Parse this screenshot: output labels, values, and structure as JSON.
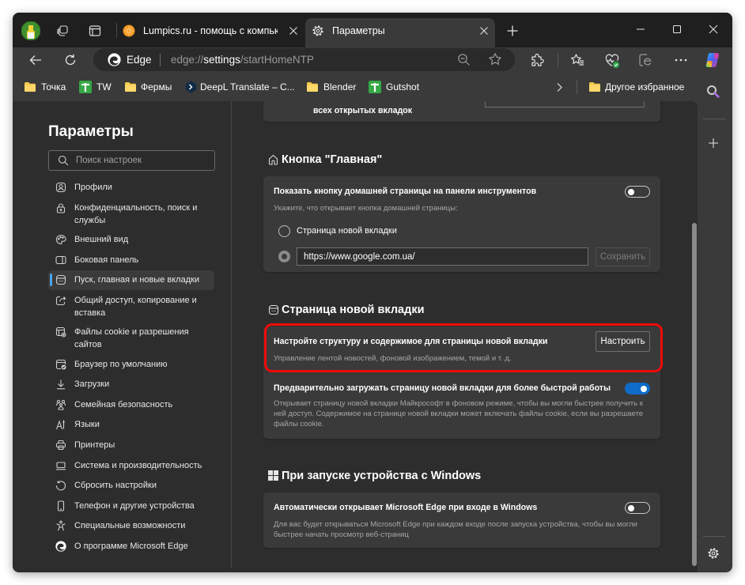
{
  "browser": {
    "tabs": [
      {
        "title": "Lumpics.ru - помощь с компьюте",
        "favicon": "orange-favicon-icon",
        "active": false
      },
      {
        "title": "Параметры",
        "favicon": "gear-icon",
        "active": true
      }
    ],
    "address_bar": {
      "brand": "Edge",
      "url_scheme": "edge://",
      "url_host": "settings",
      "url_path": "/startHomeNTP"
    },
    "toolbar_icons": [
      "back-icon",
      "refresh-icon",
      "zoom-out-icon",
      "favorite-star-icon",
      "extensions-icon",
      "favorites-icon",
      "browser-essentials-icon",
      "ie-mode-icon",
      "more-icon",
      "copilot-icon"
    ],
    "bookmarks": [
      {
        "label": "Точка",
        "icon": "folder-icon"
      },
      {
        "label": "TW",
        "icon": "green-cross-icon"
      },
      {
        "label": "Фермы",
        "icon": "folder-icon"
      },
      {
        "label": "DeepL Translate – C...",
        "icon": "deepl-icon"
      },
      {
        "label": "Blender",
        "icon": "folder-icon"
      },
      {
        "label": "Gutshot",
        "icon": "green-cross-icon"
      }
    ],
    "other_favorites": "Другое избранное"
  },
  "settings": {
    "title": "Параметры",
    "search_placeholder": "Поиск настроек",
    "nav": [
      {
        "label": "Профили",
        "icon": "profile-icon"
      },
      {
        "label": "Конфиденциальность, поиск и\nслужбы",
        "icon": "lock-icon"
      },
      {
        "label": "Внешний вид",
        "icon": "palette-icon"
      },
      {
        "label": "Боковая панель",
        "icon": "sidebar-icon"
      },
      {
        "label": "Пуск, главная и новые вкладки",
        "icon": "new-tab-page-icon",
        "selected": true
      },
      {
        "label": "Общий доступ, копирование и\nвставка",
        "icon": "share-icon"
      },
      {
        "label": "Файлы cookie и разрешения\nсайтов",
        "icon": "cookie-permissions-icon"
      },
      {
        "label": "Браузер по умолчанию",
        "icon": "default-browser-icon"
      },
      {
        "label": "Загрузки",
        "icon": "download-icon"
      },
      {
        "label": "Семейная безопасность",
        "icon": "family-icon"
      },
      {
        "label": "Языки",
        "icon": "languages-icon"
      },
      {
        "label": "Принтеры",
        "icon": "printer-icon"
      },
      {
        "label": "Система и производительность",
        "icon": "laptop-icon"
      },
      {
        "label": "Сбросить настройки",
        "icon": "reset-icon"
      },
      {
        "label": "Телефон и другие устройства",
        "icon": "phone-icon"
      },
      {
        "label": "Специальные возможности",
        "icon": "accessibility-icon"
      },
      {
        "label": "О программе Microsoft Edge",
        "icon": "edge-logo-icon"
      }
    ]
  },
  "content": {
    "top_card": {
      "title_fragment": "всех открытых вкладок"
    },
    "home_button": {
      "heading": "Кнопка \"Главная\"",
      "show_toggle": {
        "label": "Показать кнопку домашней страницы на панели инструментов",
        "on": false
      },
      "hint": "Укажите, что открывает кнопка домашней страницы:",
      "option_new_tab": {
        "label": "Страница новой вкладки",
        "selected": false
      },
      "option_url": {
        "value": "https://www.google.com.ua/",
        "selected": true
      },
      "save_label": "Сохранить",
      "save_enabled": false
    },
    "new_tab_page": {
      "heading": "Страница новой вкладки",
      "customize": {
        "title": "Настройте структуру и содержимое для страницы новой вкладки",
        "description": "Управление лентой новостей, фоновой изображением, темой и т. д.",
        "button": "Настроить",
        "highlighted": true
      },
      "preload": {
        "title": "Предварительно загружать страницу новой вкладки для более быстрой работы",
        "on": true,
        "description": "Открывает страницу новой вкладки Майкрософт в фоновом режиме, чтобы вы могли быстрее получить к\nней доступ. Содержимое на странице новой вкладки может включать файлы cookie, если вы разрешаете\nфайлы cookie."
      }
    },
    "startup": {
      "heading": "При запуске устройства с Windows",
      "auto_open": {
        "title": "Автоматически открывает Microsoft Edge при входе в Windows",
        "on": false,
        "description": "Для вас будет открываться Microsoft Edge при каждом входе после запуска устройства, чтобы вы могли\nбыстрее начать просмотр веб-страниц"
      }
    }
  },
  "colors": {
    "accent": "#0f6cc9",
    "highlight_frame": "#ee0a0a",
    "nav_indicator": "#4aa3ea"
  }
}
